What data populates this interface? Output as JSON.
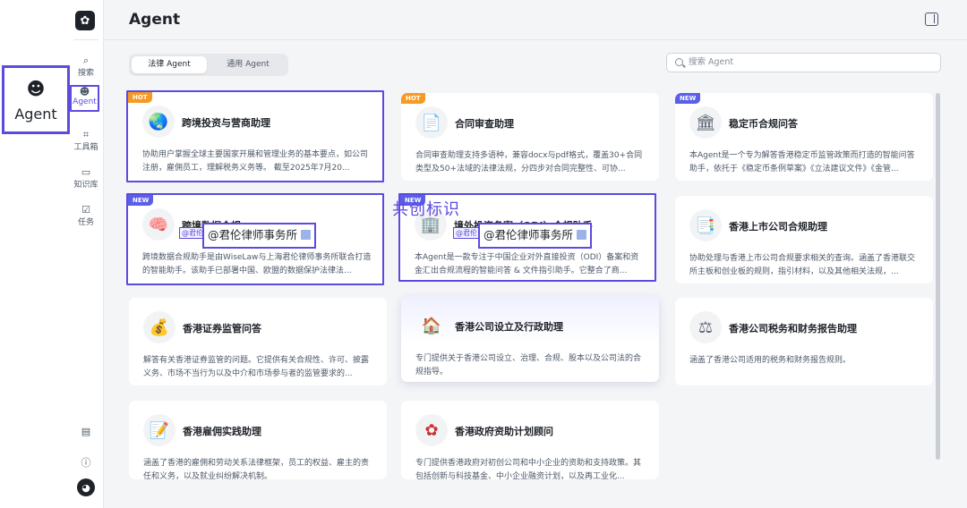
{
  "callout": {
    "label": "Agent"
  },
  "rail": {
    "items": [
      {
        "label": "搜索"
      },
      {
        "label": "Agent"
      },
      {
        "label": "工具箱"
      },
      {
        "label": "知识库"
      },
      {
        "label": "任务"
      }
    ]
  },
  "header": {
    "title": "Agent"
  },
  "tabs": [
    {
      "label": "法律 Agent",
      "active": true
    },
    {
      "label": "通用 Agent",
      "active": false
    }
  ],
  "search": {
    "placeholder": "搜索 Agent"
  },
  "annotation": "共创标识",
  "cotag_text": "@君伦律师事务所",
  "minitag_text": "@君伦",
  "cards": [
    {
      "badge": "HOT",
      "title": "跨境投资与营商助理",
      "desc": "协助用户掌握全球主要国家开展和管理业务的基本要点，如公司注册，雇佣员工，理解税务义务等。 截至2025年7月20..."
    },
    {
      "badge": "HOT",
      "title": "合同审查助理",
      "desc": "合同审查助理支持多语种，兼容docx与pdf格式，覆盖30+合同类型及50+法域的法律法规，分四步对合同完整性、可协..."
    },
    {
      "badge": "NEW",
      "title": "稳定币合规问答",
      "desc": "本Agent是一个专为解答香港稳定币监管政策而打造的智能问答助手，依托于《稳定币条例草案》《立法建议文件》《金管..."
    },
    {
      "badge": "NEW",
      "title": "跨境数据合规",
      "desc": "跨境数据合规助手是由WiseLaw与上海君伦律师事务所联合打造的智能助手。该助手已部署中国、欧盟的数据保护法律法..."
    },
    {
      "badge": "NEW",
      "title": "境外投资备案（ODI）合规助手",
      "desc": "本Agent是一款专注于中国企业对外直接投资（ODI）备案和资金汇出合规流程的智能问答 & 文件指引助手。它整合了商..."
    },
    {
      "badge": "",
      "title": "香港上市公司合规助理",
      "desc": "协助处理与香港上市公司合规要求相关的查询。涵盖了香港联交所主板和创业板的规则，指引材料，以及其他相关法规，..."
    },
    {
      "badge": "",
      "title": "香港证券监管问答",
      "desc": "解答有关香港证券监管的问题。它提供有关合规性、许可、披露义务、市场不当行为以及中介和市场参与者的监管要求的..."
    },
    {
      "badge": "",
      "title": "香港公司设立及行政助理",
      "desc": "专门提供关于香港公司设立、治理、合规、股本以及公司法的合规指导。"
    },
    {
      "badge": "",
      "title": "香港公司税务和财务报告助理",
      "desc": "涵盖了香港公司适用的税务和财务报告规则。"
    },
    {
      "badge": "",
      "title": "香港雇佣实践助理",
      "desc": "涵盖了香港的雇佣和劳动关系法律框架，员工的权益、雇主的责任和义务，以及就业纠纷解决机制。"
    },
    {
      "badge": "",
      "title": "香港政府资助计划顾问",
      "desc": "专门提供香港政府对初创公司和中小企业的资助和支持政策。其包括创新与科技基金、中小企业融资计划，以及再工业化..."
    }
  ]
}
